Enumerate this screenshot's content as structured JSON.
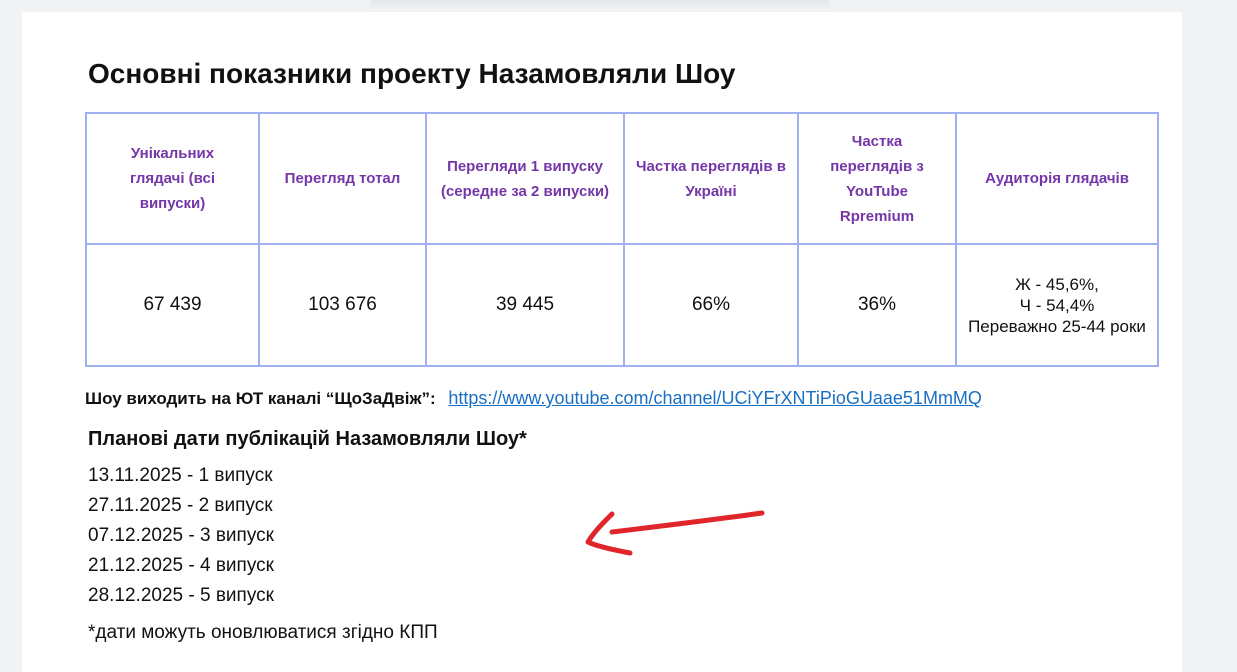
{
  "document": {
    "title": "Основні показники проекту Назамовляли Шоу",
    "kpi_table": {
      "headers": [
        "Унікальних глядачі (всі випуски)",
        "Перегляд тотал",
        "Перегляди 1 випуску (середне за 2 випуски)",
        "Частка переглядів в Україні",
        "Частка переглядів з YouTube Rpremium",
        "Аудиторія глядачів"
      ],
      "values": [
        "67 439",
        "103 676",
        "39 445",
        "66%",
        "36%",
        "Ж - 45,6%,\nЧ - 54,4%\nПереважно 25-44 роки"
      ]
    },
    "channel": {
      "label": "Шоу виходить на ЮТ каналі “ЩоЗаДвіж”:",
      "url": "https://www.youtube.com/channel/UCiYFrXNTiPioGUaae51MmMQ"
    },
    "schedule": {
      "title": "Планові дати публікацій Назамовляли Шоу*",
      "items": [
        "13.11.2025 - 1 випуск",
        "27.11.2025 - 2 випуск",
        "07.12.2025 - 3 випуск",
        "21.12.2025 - 4 випуск",
        "28.12.2025 - 5 випуск"
      ],
      "footnote": "*дати можуть оновлюватися згідно КПП"
    },
    "annotation": {
      "icon": "red-hand-drawn-arrow-icon",
      "color": "#e0262b"
    }
  }
}
